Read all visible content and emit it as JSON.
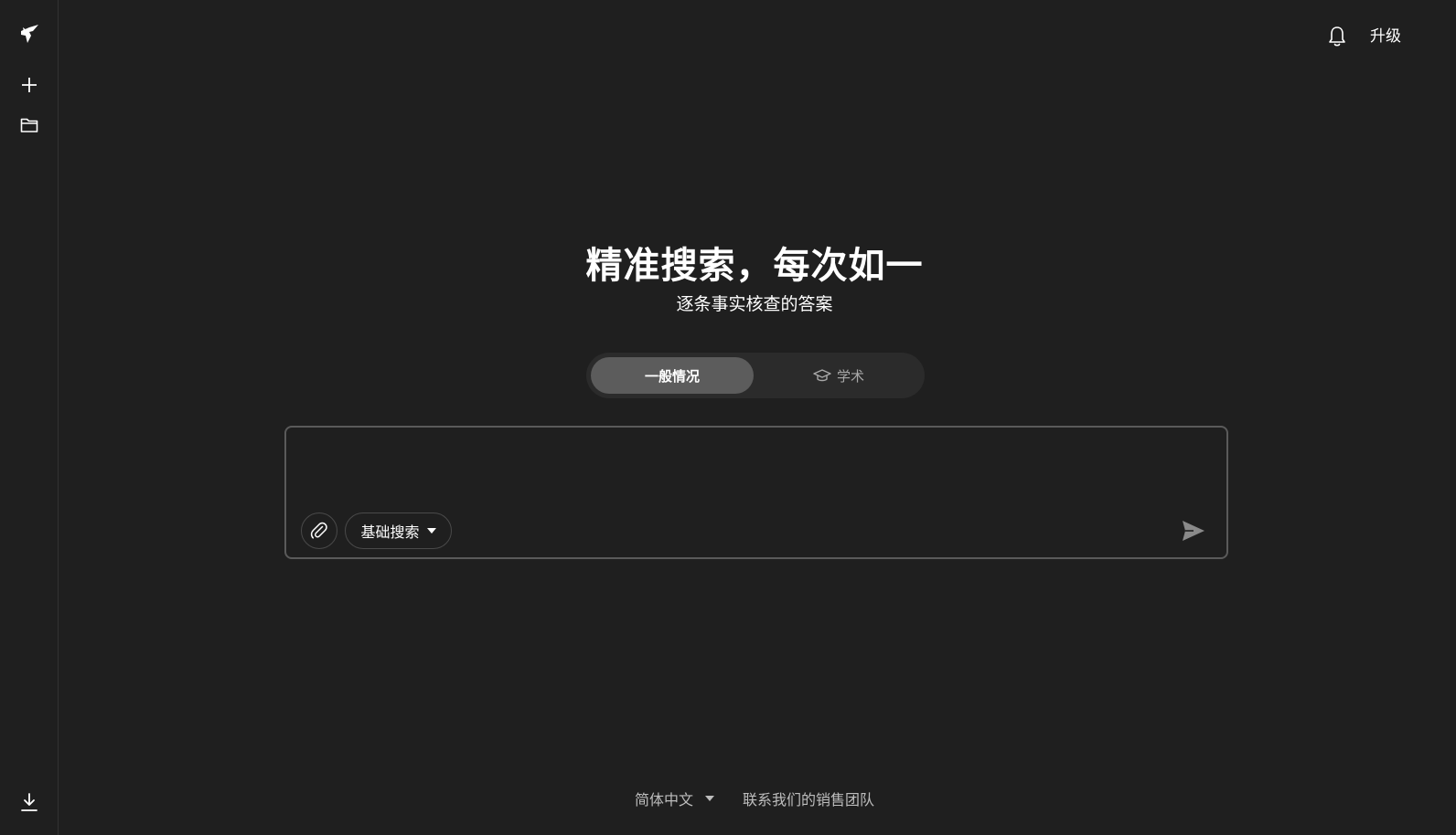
{
  "sidebar": {
    "logo_icon": "logo-icon",
    "new_icon": "plus-icon",
    "folder_icon": "folder-icon",
    "download_icon": "download-icon"
  },
  "topbar": {
    "bell_icon": "bell-icon",
    "upgrade_label": "升级"
  },
  "hero": {
    "title": "精准搜索，每次如一",
    "subtitle": "逐条事实核查的答案"
  },
  "mode_switch": {
    "active_label": "一般情况",
    "inactive_label": "学术",
    "inactive_icon": "graduation-cap-icon"
  },
  "query": {
    "value": "",
    "attach_icon": "paperclip-icon",
    "search_mode_label": "基础搜索",
    "send_icon": "send-icon"
  },
  "footer": {
    "language_label": "简体中文",
    "contact_label": "联系我们的销售团队"
  },
  "colors": {
    "background": "#1f1f1f",
    "panel": "#2b2b2b",
    "active_tab": "#5c5c5c",
    "border": "#5a5a5a",
    "muted_text": "#bdbdbd"
  }
}
